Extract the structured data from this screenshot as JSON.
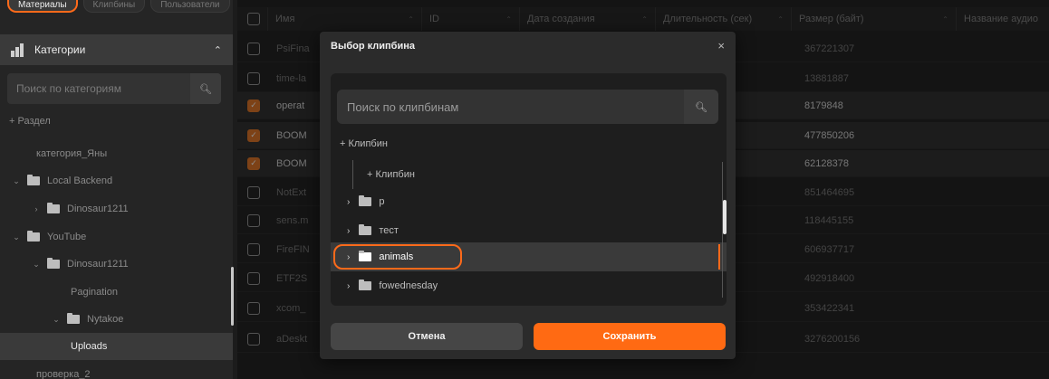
{
  "tabs": [
    "Материалы",
    "Клипбины",
    "Пользователи"
  ],
  "sidebar": {
    "header": "Категории",
    "search_placeholder": "Поиск по категориям",
    "add_section": "+ Раздел",
    "items": [
      {
        "label": "категория_Яны"
      },
      {
        "label": "Local Backend"
      },
      {
        "label": "Dinosaur1211"
      },
      {
        "label": "YouTube"
      },
      {
        "label": "Dinosaur1211"
      },
      {
        "label": "Pagination"
      },
      {
        "label": "Nytakoe"
      },
      {
        "label": "Uploads"
      },
      {
        "label": "проверка_2"
      }
    ]
  },
  "table": {
    "columns": [
      "Имя",
      "ID",
      "Дата создания",
      "Длительность (сек)",
      "Размер (байт)",
      "Название аудио"
    ],
    "rows": [
      {
        "name": "PsiFina",
        "size": "367221307",
        "checked": false
      },
      {
        "name": "time-la",
        "size": "13881887",
        "checked": false
      },
      {
        "name": "operat",
        "size": "8179848",
        "checked": true
      },
      {
        "name": "BOOM",
        "size": "477850206",
        "checked": true
      },
      {
        "name": "BOOM",
        "size": "62128378",
        "checked": true
      },
      {
        "name": "NotExt",
        "size": "851464695",
        "checked": false
      },
      {
        "name": "sens.m",
        "size": "118445155",
        "checked": false
      },
      {
        "name": "FireFIN",
        "size": "606937717",
        "checked": false
      },
      {
        "name": "ETF2S",
        "size": "492918400",
        "checked": false
      },
      {
        "name": "xcom_",
        "size": "353422341",
        "checked": false
      },
      {
        "name": "aDeskt",
        "size": "3276200156",
        "checked": false
      }
    ]
  },
  "modal": {
    "title": "Выбор клипбина",
    "close": "×",
    "search_placeholder": "Поиск по клипбинам",
    "add_clipbin": "+ Клипбин",
    "add_clipbin_nested": "+ Клипбин",
    "items": [
      "р",
      "тест",
      "animals",
      "fowednesday"
    ],
    "cancel_label": "Отмена",
    "save_label": "Сохранить"
  },
  "colors": {
    "accent": "#ff6a13",
    "background": "#1c1c1c"
  }
}
